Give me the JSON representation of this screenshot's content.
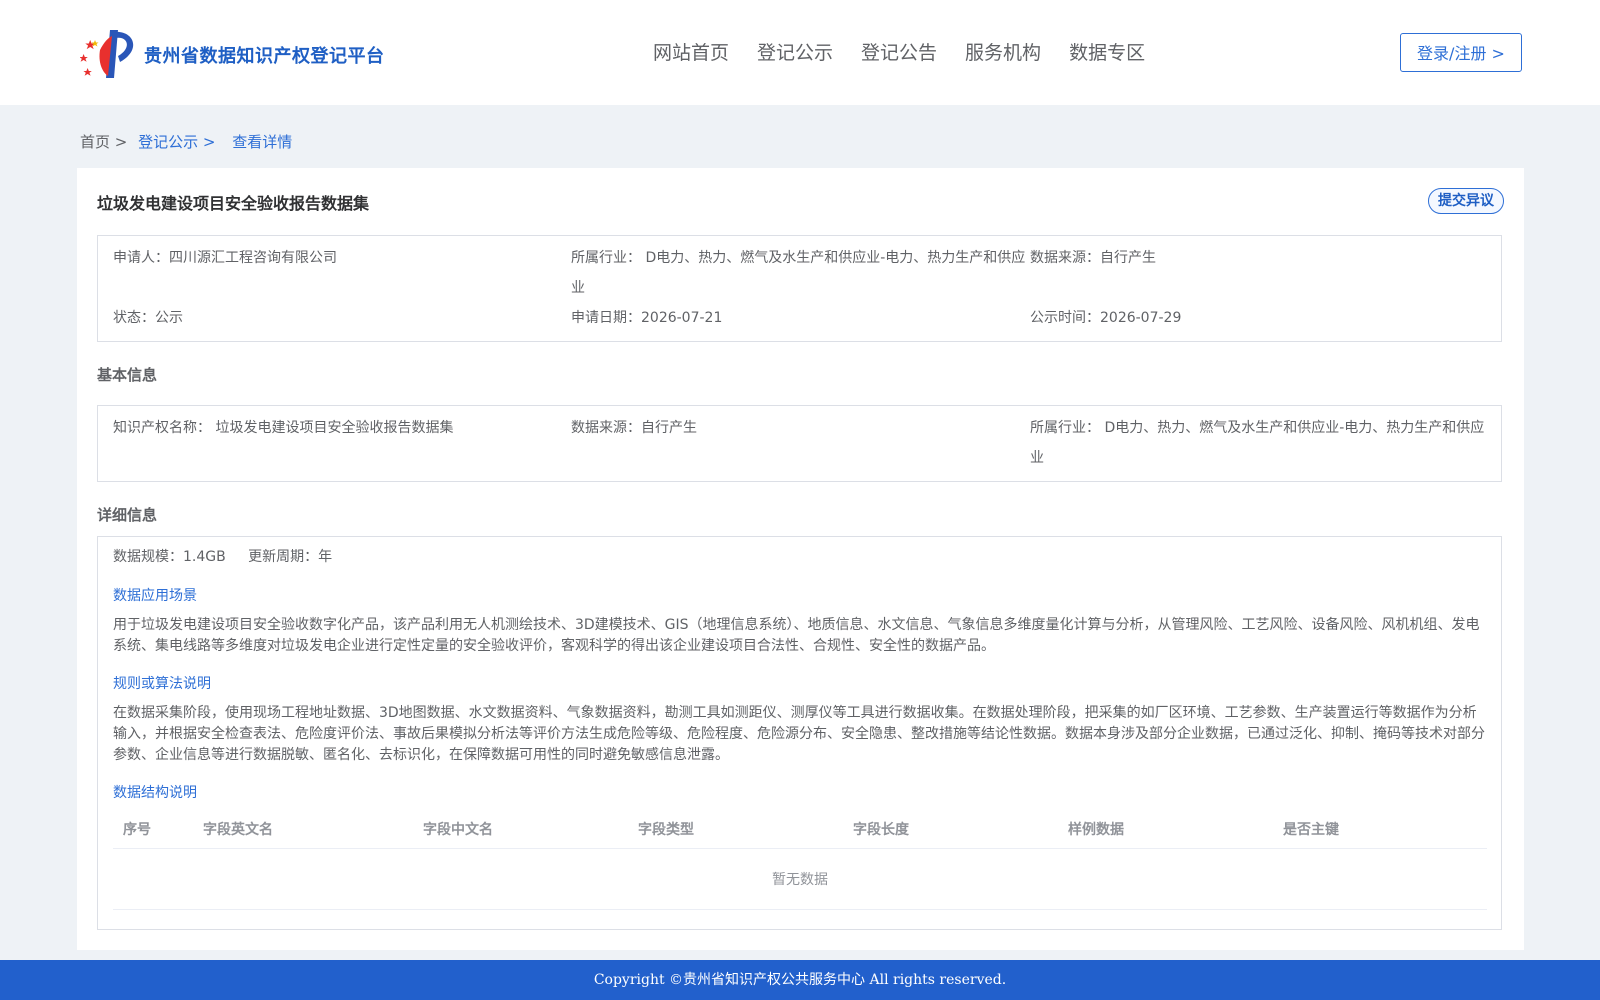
{
  "header": {
    "site_title": "贵州省数据知识产权登记平台",
    "nav": [
      "网站首页",
      "登记公示",
      "登记公告",
      "服务机构",
      "数据专区"
    ],
    "login_label": "登录/注册 >"
  },
  "breadcrumb": {
    "home": "首页 >",
    "level2": "登记公示 >",
    "current": "查看详情"
  },
  "item": {
    "title": "垃圾发电建设项目安全验收报告数据集",
    "objection_label": "提交异议"
  },
  "summary": {
    "applicant": "申请人：四川源汇工程咨询有限公司",
    "industry": "所属行业： D电力、热力、燃气及水生产和供应业-电力、热力生产和供应业",
    "source": "数据来源：自行产生",
    "status": "状态：公示",
    "apply_date": "申请日期：2026-07-21",
    "publish_date": "公示时间：2026-07-29"
  },
  "basic": {
    "section_title": "基本信息",
    "ip_name": "知识产权名称： 垃圾发电建设项目安全验收报告数据集",
    "source": "数据来源：自行产生",
    "industry": "所属行业： D电力、热力、燃气及水生产和供应业-电力、热力生产和供应业"
  },
  "detail": {
    "section_title": "详细信息",
    "scale": "数据规模：1.4GB",
    "cycle": "更新周期：年",
    "scene_label": "数据应用场景",
    "scene_text": "用于垃圾发电建设项目安全验收数字化产品，该产品利用无人机测绘技术、3D建模技术、GIS（地理信息系统）、地质信息、水文信息、气象信息多维度量化计算与分析，从管理风险、工艺风险、设备风险、风机机组、发电系统、集电线路等多维度对垃圾发电企业进行定性定量的安全验收评价，客观科学的得出该企业建设项目合法性、合规性、安全性的数据产品。",
    "algo_label": "规则或算法说明",
    "algo_text": "在数据采集阶段，使用现场工程地址数据、3D地图数据、水文数据资料、气象数据资料，勘测工具如测距仪、测厚仪等工具进行数据收集。在数据处理阶段，把采集的如厂区环境、工艺参数、生产装置运行等数据作为分析输入，并根据安全检查表法、危险度评价法、事故后果模拟分析法等评价方法生成危险等级、危险程度、危险源分布、安全隐患、整改措施等结论性数据。数据本身涉及部分企业数据，已通过泛化、抑制、掩码等技术对部分参数、企业信息等进行数据脱敏、匿名化、去标识化，在保障数据可用性的同时避免敏感信息泄露。",
    "struct_label": "数据结构说明",
    "table_headers": [
      "序号",
      "字段英文名",
      "字段中文名",
      "字段类型",
      "字段长度",
      "样例数据",
      "是否主键"
    ],
    "empty_text": "暂无数据"
  },
  "footer": {
    "copyright": "Copyright ©贵州省知识产权公共服务中心 All rights reserved."
  },
  "colors": {
    "brand": "#1f5fc4",
    "link": "#2e6fd6",
    "footer_bg": "#2260cc",
    "page_bg": "#eef2f6"
  }
}
